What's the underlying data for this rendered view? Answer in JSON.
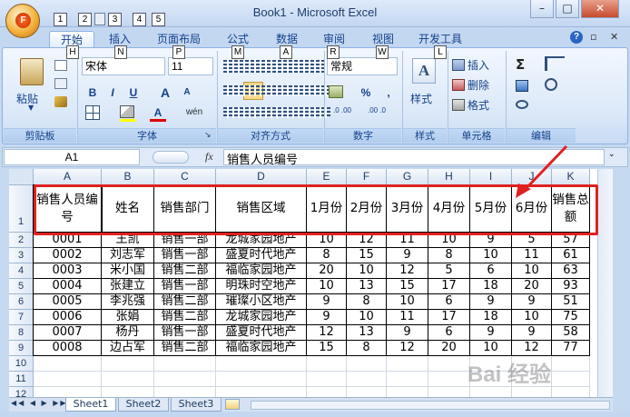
{
  "window": {
    "title": "Book1 - Microsoft Excel",
    "office_logo": "F",
    "qat_keytips": [
      "1",
      "2",
      "3",
      "4",
      "5"
    ],
    "controls": {
      "minimize": "–",
      "maximize": "□",
      "close": "✕"
    }
  },
  "ribbon": {
    "tabs": [
      "开始",
      "插入",
      "页面布局",
      "公式",
      "数据",
      "审阅",
      "视图",
      "开发工具"
    ],
    "tab_keytips": [
      "H",
      "N",
      "P",
      "M",
      "A",
      "R",
      "W",
      "L"
    ],
    "active_tab": "开始",
    "help": {
      "icon": "help-icon",
      "restore": "▫",
      "close": "✕"
    },
    "groups": {
      "clipboard": {
        "label": "剪贴板",
        "paste": "粘贴"
      },
      "font": {
        "label": "字体",
        "name": "宋体",
        "size": "11",
        "bold": "B",
        "italic": "I",
        "underline": "U",
        "grow": "A",
        "shrink": "A",
        "color_letter": "A",
        "phonetic": "wén"
      },
      "alignment": {
        "label": "对齐方式"
      },
      "number": {
        "label": "数字",
        "format": "常规",
        "percent": "%",
        "comma": ",",
        "inc_decimal": ".0 .00",
        "dec_decimal": ".00 .0"
      },
      "styles": {
        "label": "样式",
        "styles_button": "样式"
      },
      "cells": {
        "label": "单元格",
        "insert": "插入",
        "delete": "删除",
        "format": "格式"
      },
      "editing": {
        "label": "编辑",
        "sum": "Σ"
      }
    },
    "accent": "#15428b"
  },
  "formula_bar": {
    "name_box": "A1",
    "fx": "fx",
    "content": "销售人员编号"
  },
  "sheet": {
    "columns": [
      "A",
      "B",
      "C",
      "D",
      "E",
      "F",
      "G",
      "H",
      "I",
      "J",
      "K"
    ],
    "rows": [
      "1",
      "2",
      "3",
      "4",
      "5",
      "6",
      "7",
      "8",
      "9",
      "10",
      "11",
      "12"
    ],
    "header": [
      "销售人员编号",
      "姓名",
      "销售部门",
      "销售区域",
      "1月份",
      "2月份",
      "3月份",
      "4月份",
      "5月份",
      "6月份",
      "销售总额"
    ],
    "data": [
      [
        "0001",
        "王凯",
        "销售一部",
        "龙城家园地产",
        "10",
        "12",
        "11",
        "10",
        "9",
        "5",
        "57"
      ],
      [
        "0002",
        "刘志军",
        "销售一部",
        "盛夏时代地产",
        "8",
        "15",
        "9",
        "8",
        "10",
        "11",
        "61"
      ],
      [
        "0003",
        "米小国",
        "销售二部",
        "福临家园地产",
        "20",
        "10",
        "12",
        "5",
        "6",
        "10",
        "63"
      ],
      [
        "0004",
        "张建立",
        "销售一部",
        "明珠时空地产",
        "10",
        "13",
        "15",
        "17",
        "18",
        "20",
        "93"
      ],
      [
        "0005",
        "李兆强",
        "销售二部",
        "璀璨小区地产",
        "9",
        "8",
        "10",
        "6",
        "9",
        "9",
        "51"
      ],
      [
        "0006",
        "张娟",
        "销售二部",
        "龙城家园地产",
        "9",
        "10",
        "11",
        "17",
        "18",
        "10",
        "75"
      ],
      [
        "0007",
        "杨丹",
        "销售一部",
        "盛夏时代地产",
        "12",
        "13",
        "9",
        "6",
        "9",
        "9",
        "58"
      ],
      [
        "0008",
        "边占军",
        "销售二部",
        "福临家园地产",
        "15",
        "8",
        "12",
        "20",
        "10",
        "12",
        "77"
      ]
    ],
    "sheet_tabs": [
      "Sheet1",
      "Sheet2",
      "Sheet3"
    ],
    "active_sheet": "Sheet1",
    "watermark": "Bai 经验"
  },
  "annotation_color": "#e02121"
}
